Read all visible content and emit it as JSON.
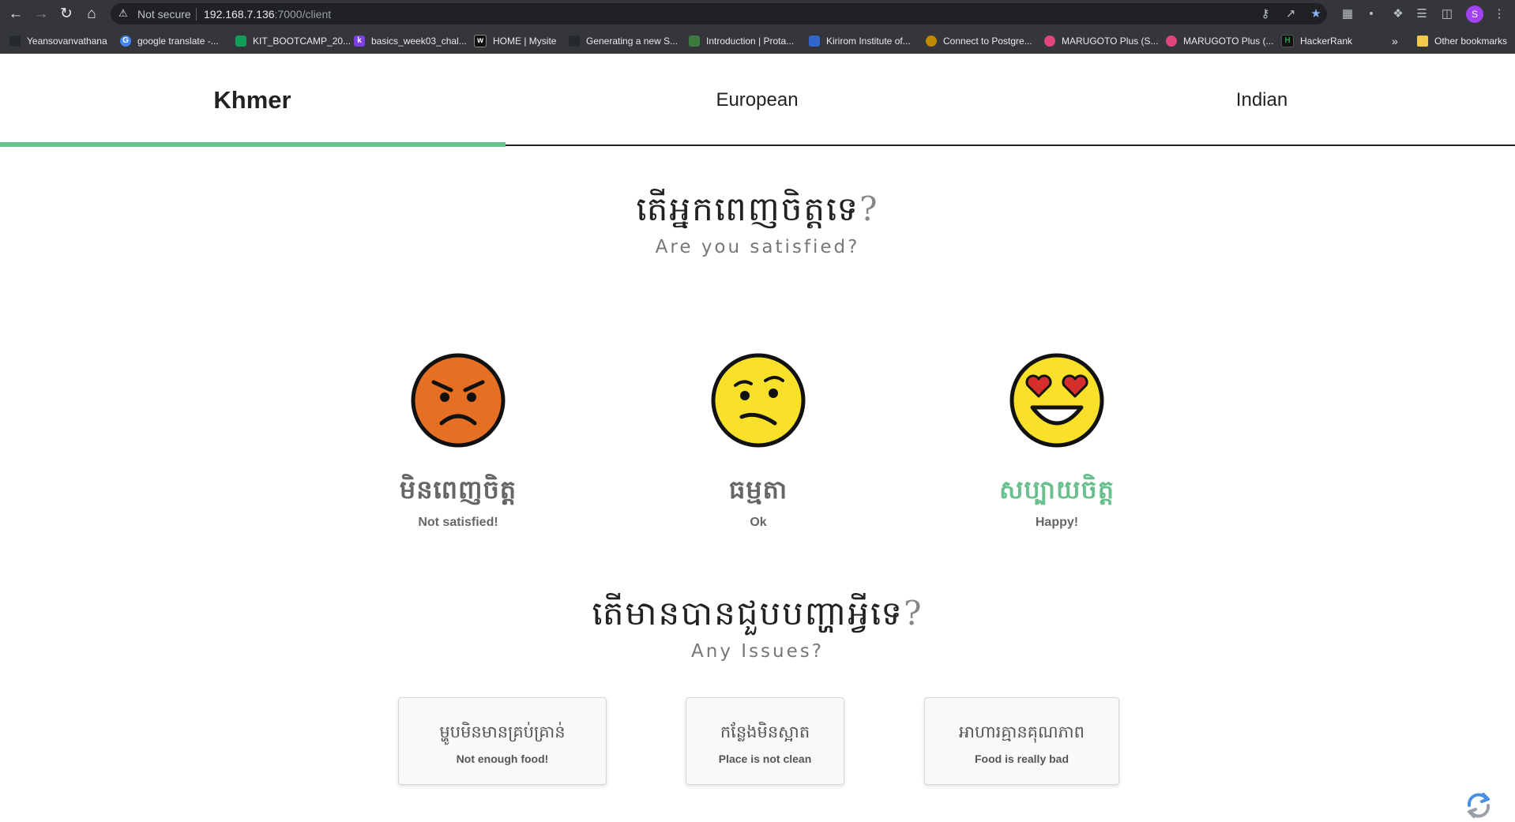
{
  "browser": {
    "security_label": "Not secure",
    "url_host": "192.168.7.136",
    "url_path": ":7000/client",
    "profile_initial": "S",
    "bookmarks": [
      {
        "label": "Yeansovanvathana",
        "icon": "github-icon",
        "color": "#24292e"
      },
      {
        "label": "google translate -...",
        "icon": "google-icon",
        "color": "#4285f4"
      },
      {
        "label": "KIT_BOOTCAMP_20...",
        "icon": "drive-icon",
        "color": "#0f9d58"
      },
      {
        "label": "basics_week03_chal...",
        "icon": "k-icon",
        "color": "#7b3fe4"
      },
      {
        "label": "HOME | Mysite",
        "icon": "wix-icon",
        "color": "#111111"
      },
      {
        "label": "Generating a new S...",
        "icon": "github-icon",
        "color": "#24292e"
      },
      {
        "label": "Introduction | Prota...",
        "icon": "protagonist-icon",
        "color": "#3d7a3d"
      },
      {
        "label": "Kirirom Institute of...",
        "icon": "kit-icon",
        "color": "#3366cc"
      },
      {
        "label": "Connect to Postgre...",
        "icon": "postgres-icon",
        "color": "#c08a00"
      },
      {
        "label": "MARUGOTO Plus (S...",
        "icon": "marugoto-icon",
        "color": "#e0457b"
      },
      {
        "label": "MARUGOTO Plus (...",
        "icon": "marugoto-icon",
        "color": "#e0457b"
      },
      {
        "label": "HackerRank",
        "icon": "hackerrank-icon",
        "color": "#1ba94c"
      }
    ],
    "overflow_label": "»",
    "other_bookmarks": "Other bookmarks"
  },
  "tabs": [
    {
      "label": "Khmer",
      "active": true
    },
    {
      "label": "European",
      "active": false
    },
    {
      "label": "Indian",
      "active": false
    }
  ],
  "satisfaction": {
    "title_km": "តើអ្នកពេញចិត្តទេ",
    "title_qm": "?",
    "subtitle": "Are you satisfied?",
    "options": [
      {
        "km": "មិនពេញចិត្ត",
        "en": "Not satisfied!",
        "icon": "angry-face-icon",
        "color": "#e56f22"
      },
      {
        "km": "ធម្មតា",
        "en": "Ok",
        "icon": "confused-face-icon",
        "color": "#f9e12a"
      },
      {
        "km": "សប្បាយចិត្ត",
        "en": "Happy!",
        "icon": "heart-eyes-face-icon",
        "color": "#f9e12a"
      }
    ]
  },
  "issues": {
    "title_km": "តើមានបានជួបបញ្ហាអ្វីទេ",
    "title_qm": "?",
    "subtitle": "Any Issues?",
    "options": [
      {
        "km": "ម្ហូបមិនមានគ្រប់គ្រាន់",
        "en": "Not enough food!"
      },
      {
        "km": "កន្លែងមិនស្អាត",
        "en": "Place is not clean"
      },
      {
        "km": "អាហារគ្មានគុណភាព",
        "en": "Food is really bad"
      }
    ]
  },
  "accent_color": "#6bbf8e"
}
